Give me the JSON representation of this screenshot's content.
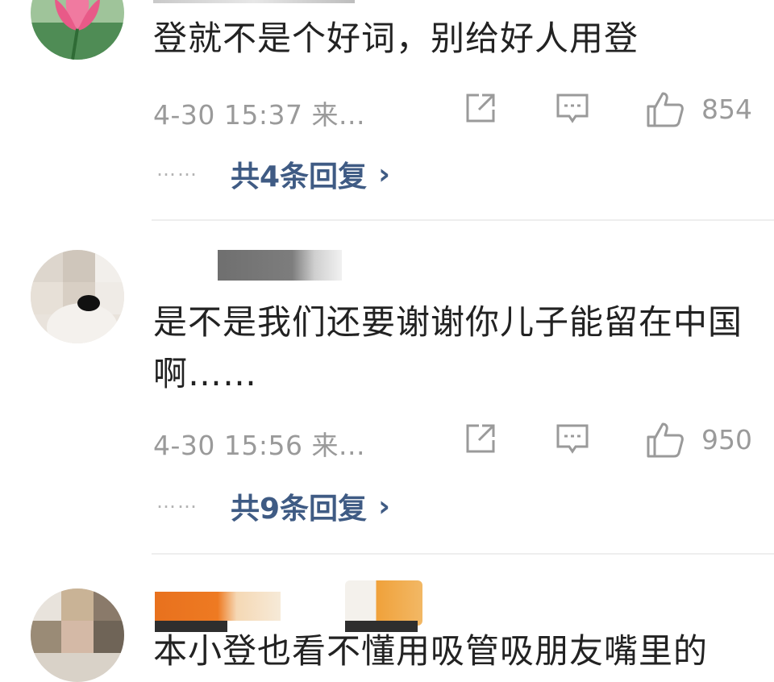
{
  "comments": [
    {
      "text": "登就不是个好词，别给好人用登",
      "time": "4-30 15:37 来...",
      "likes": "854",
      "replies": {
        "dots": "……",
        "label": "共4条回复",
        "chevron": "›"
      }
    },
    {
      "text": "是不是我们还要谢谢你儿子能留在中国啊……",
      "time": "4-30 15:56 来...",
      "likes": "950",
      "replies": {
        "dots": "……",
        "label": "共9条回复",
        "chevron": "›"
      }
    },
    {
      "text": "本小登也看不懂用吸管吸朋友嘴里的"
    }
  ],
  "icons": {
    "share": "share-icon",
    "comment": "comment-icon",
    "like": "thumbs-up-icon"
  },
  "colors": {
    "text": "#222222",
    "meta": "#9a9a9a",
    "reply_link": "#3f5b84",
    "divider": "#eeeeee"
  }
}
